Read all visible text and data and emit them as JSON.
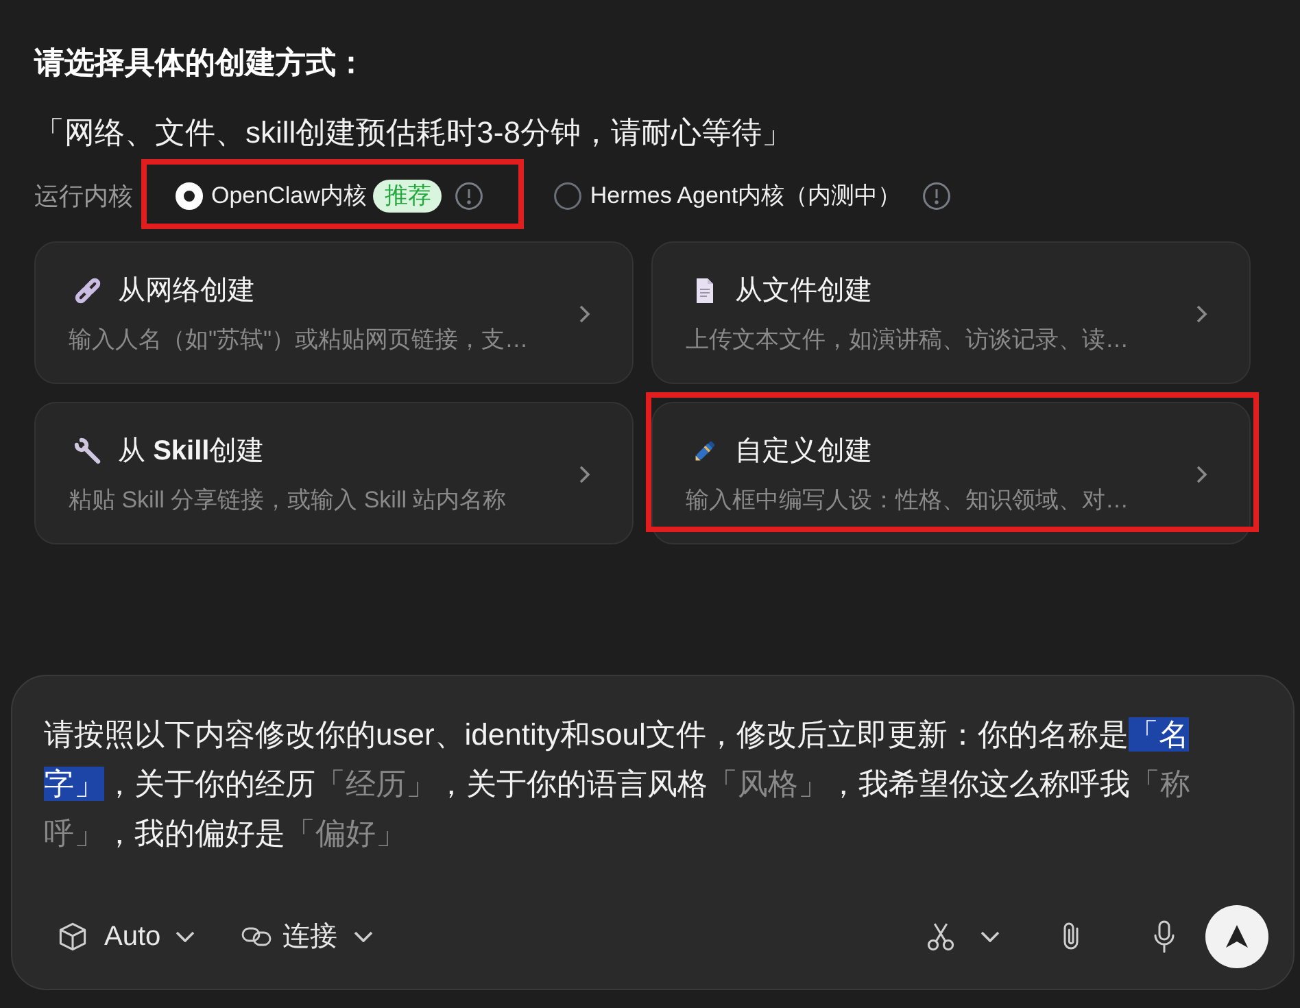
{
  "heading": "请选择具体的创建方式：",
  "notice": "「网络、文件、skill创建预估耗时3-8分钟，请耐心等待」",
  "kernel": {
    "label": "运行内核",
    "options": [
      {
        "label": "OpenClaw内核",
        "badge": "推荐",
        "selected": true,
        "highlighted": true
      },
      {
        "label": "Hermes Agent内核（内测中）",
        "selected": false,
        "highlighted": false
      }
    ]
  },
  "methods": [
    {
      "kind": "web",
      "title": "从网络创建",
      "description": "输入人名（如\"苏轼\"）或粘贴网页链接，支…",
      "highlighted": false
    },
    {
      "kind": "file",
      "title": "从文件创建",
      "description": "上传文本文件，如演讲稿、访谈记录、读…",
      "highlighted": false
    },
    {
      "kind": "skill",
      "title": "从 **Skill**创建",
      "description": "粘贴 Skill 分享链接，或输入 Skill 站内名称",
      "highlighted": false
    },
    {
      "kind": "custom",
      "title": "自定义创建",
      "description": "输入框中编写人设：性格、知识领域、对…",
      "highlighted": true
    }
  ],
  "composer": {
    "segments": [
      {
        "kind": "text",
        "text": "请按照以下内容修改你的user、identity和soul文件，修改后立即更新：你的名称是",
        "selected": false
      },
      {
        "kind": "slot",
        "text": "「名字」",
        "selected": true
      },
      {
        "kind": "text",
        "text": "，关于你的经历",
        "selected": false
      },
      {
        "kind": "slot",
        "text": "「经历」",
        "selected": false
      },
      {
        "kind": "text",
        "text": "，关于你的语言风格",
        "selected": false
      },
      {
        "kind": "slot",
        "text": "「风格」",
        "selected": false
      },
      {
        "kind": "text",
        "text": "，我希望你这么称呼我",
        "selected": false
      },
      {
        "kind": "slot",
        "text": "「称呼」",
        "selected": false
      },
      {
        "kind": "text",
        "text": "，我的偏好是",
        "selected": false
      },
      {
        "kind": "slot",
        "text": "「偏好」",
        "selected": false
      }
    ],
    "mode": "Auto",
    "connect": "连接"
  }
}
